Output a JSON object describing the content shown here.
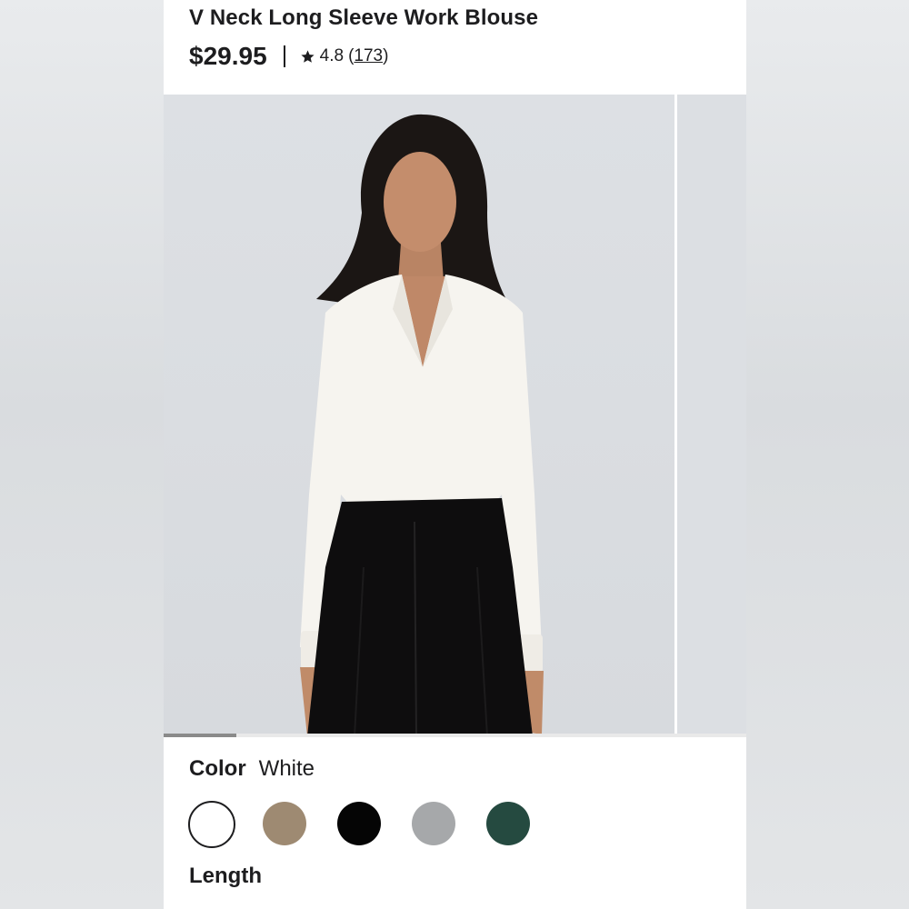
{
  "product": {
    "title": "V Neck Long Sleeve Work Blouse",
    "price": "$29.95",
    "rating": "4.8",
    "review_open": "(",
    "review_count": "173",
    "review_close": ")"
  },
  "gallery": {
    "progress_fraction": 0.125
  },
  "color": {
    "label": "Color",
    "selected": "White",
    "options": [
      {
        "name": "White",
        "hex": "#ffffff"
      },
      {
        "name": "Taupe",
        "hex": "#9e8a72"
      },
      {
        "name": "Black",
        "hex": "#050505"
      },
      {
        "name": "Gray",
        "hex": "#a6a8aa"
      },
      {
        "name": "Dark Green",
        "hex": "#254a40"
      }
    ]
  },
  "length": {
    "label": "Length"
  },
  "icons": {
    "rating": "star-icon"
  }
}
